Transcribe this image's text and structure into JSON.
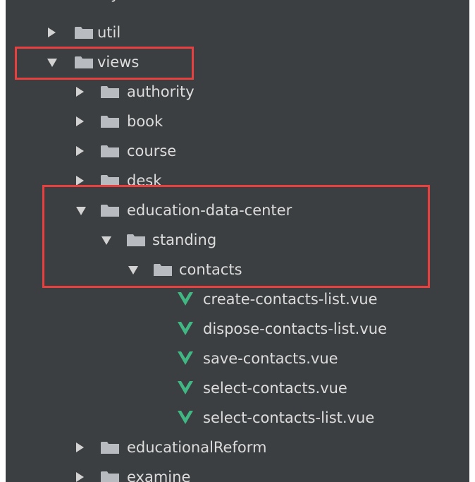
{
  "tree": {
    "partial_top": "styles",
    "items": [
      {
        "label": "util",
        "state": "collapsed",
        "kind": "folder"
      },
      {
        "label": "views",
        "state": "expanded",
        "kind": "folder"
      },
      {
        "label": "authority",
        "state": "collapsed",
        "kind": "folder"
      },
      {
        "label": "book",
        "state": "collapsed",
        "kind": "folder"
      },
      {
        "label": "course",
        "state": "collapsed",
        "kind": "folder"
      },
      {
        "label": "desk",
        "state": "collapsed",
        "kind": "folder"
      },
      {
        "label": "education-data-center",
        "state": "expanded",
        "kind": "folder"
      },
      {
        "label": "standing",
        "state": "expanded",
        "kind": "folder"
      },
      {
        "label": "contacts",
        "state": "expanded",
        "kind": "folder"
      },
      {
        "label": "create-contacts-list.vue",
        "kind": "vue-file"
      },
      {
        "label": "dispose-contacts-list.vue",
        "kind": "vue-file"
      },
      {
        "label": "save-contacts.vue",
        "kind": "vue-file"
      },
      {
        "label": "select-contacts.vue",
        "kind": "vue-file"
      },
      {
        "label": "select-contacts-list.vue",
        "kind": "vue-file"
      },
      {
        "label": "educationalReform",
        "state": "collapsed",
        "kind": "folder"
      },
      {
        "label": "examine",
        "state": "collapsed",
        "kind": "folder"
      }
    ]
  },
  "colors": {
    "panel_bg": "#3c3f41",
    "text": "#dcdcdc",
    "folder": "#b8bcc0",
    "vue_green": "#41b883",
    "highlight_red": "#e8403f"
  },
  "icons": {
    "folder": "folder-icon",
    "vue": "vue-file-icon",
    "collapsed": "chevron-right-icon",
    "expanded": "chevron-down-icon"
  }
}
